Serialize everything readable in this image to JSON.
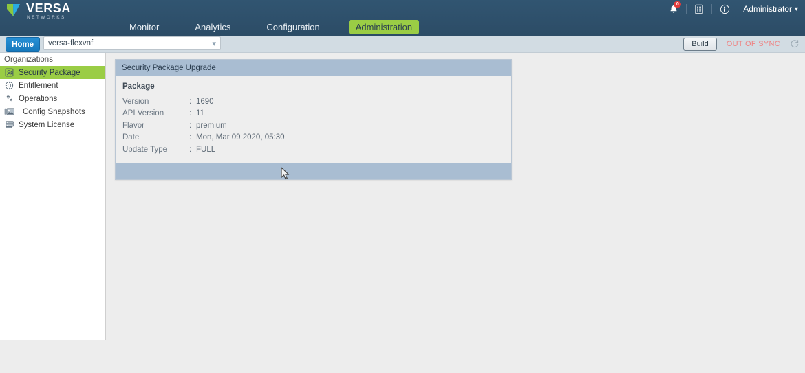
{
  "header": {
    "logo_title": "VERSA",
    "logo_sub": "NETWORKS",
    "logo_icon": "versa-v-logo-icon",
    "notifications_icon": "bell-icon",
    "notifications_count": "0",
    "tasks_icon": "task-list-icon",
    "info_icon": "info-circle-icon",
    "user_label": "Administrator",
    "user_chevron_icon": "chevron-down-icon"
  },
  "nav": {
    "tabs": [
      {
        "label": "Monitor",
        "active": false
      },
      {
        "label": "Analytics",
        "active": false
      },
      {
        "label": "Configuration",
        "active": false
      },
      {
        "label": "Administration",
        "active": true
      }
    ]
  },
  "toolbar": {
    "home_label": "Home",
    "org_value": "versa-flexvnf",
    "org_placeholder": "versa-flexvnf",
    "org_chevron_icon": "chevron-down-icon",
    "build_label": "Build",
    "sync_status": "OUT OF SYNC",
    "refresh_icon": "refresh-icon"
  },
  "sidebar": {
    "heading": "Organizations",
    "items": [
      {
        "label": "Security Package",
        "icon": "security-package-icon",
        "selected": true,
        "indented": false
      },
      {
        "label": "Entitlement",
        "icon": "entitlement-gear-icon",
        "selected": false,
        "indented": false
      },
      {
        "label": "Operations",
        "icon": "operations-gears-icon",
        "selected": false,
        "indented": false
      },
      {
        "label": "Config Snapshots",
        "icon": "config-snapshots-icon",
        "selected": false,
        "indented": true
      },
      {
        "label": "System License",
        "icon": "system-license-icon",
        "selected": false,
        "indented": false
      }
    ]
  },
  "panel": {
    "title": "Security Package Upgrade",
    "section_label": "Package",
    "rows": [
      {
        "key": "Version",
        "value": "1690"
      },
      {
        "key": "API Version",
        "value": "11"
      },
      {
        "key": "Flavor",
        "value": "premium"
      },
      {
        "key": "Date",
        "value": "Mon, Mar 09 2020, 05:30"
      },
      {
        "key": "Update Type",
        "value": "FULL"
      }
    ],
    "separator": ":"
  },
  "colors": {
    "header_bg": "#2e4f6b",
    "accent_green": "#9acd45",
    "toolbar_bg": "#d2dce3",
    "panel_header_bg": "#a9bdd2",
    "status_red": "#ef8282",
    "home_blue": "#1b83c9"
  }
}
